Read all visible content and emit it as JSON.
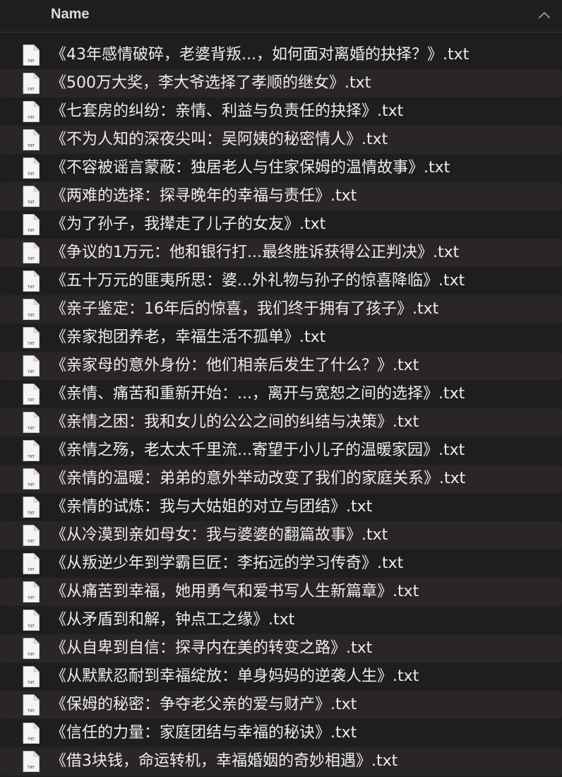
{
  "header": {
    "column_name": "Name",
    "sort_icon": "chevron-up-icon"
  },
  "file_icon": {
    "type": "txt-document-icon",
    "badge": "TXT"
  },
  "files": [
    "《43年感情破碎，老婆背叛...，如何面对离婚的抉择？》.txt",
    "《500万大奖，李大爷选择了孝顺的继女》.txt",
    "《七套房的纠纷：亲情、利益与负责任的抉择》.txt",
    "《不为人知的深夜尖叫：吴阿姨的秘密情人》.txt",
    "《不容被谣言蒙蔽：独居老人与住家保姆的温情故事》.txt",
    "《两难的选择：探寻晚年的幸福与责任》.txt",
    "《为了孙子，我撵走了儿子的女友》.txt",
    "《争议的1万元：他和银行打...最终胜诉获得公正判决》.txt",
    "《五十万元的匪夷所思：婆...外礼物与孙子的惊喜降临》.txt",
    "《亲子鉴定：16年后的惊喜，我们终于拥有了孩子》.txt",
    "《亲家抱团养老，幸福生活不孤单》.txt",
    "《亲家母的意外身份：他们相亲后发生了什么？》.txt",
    "《亲情、痛苦和重新开始：...，离开与宽恕之间的选择》.txt",
    "《亲情之困：我和女儿的公公之间的纠结与决策》.txt",
    "《亲情之殇，老太太千里流...寄望于小儿子的温暖家园》.txt",
    "《亲情的温暖：弟弟的意外举动改变了我们的家庭关系》.txt",
    "《亲情的试炼：我与大姑姐的对立与团结》.txt",
    "《从冷漠到亲如母女：我与婆婆的翻篇故事》.txt",
    "《从叛逆少年到学霸巨匠：李拓远的学习传奇》.txt",
    "《从痛苦到幸福，她用勇气和爱书写人生新篇章》.txt",
    "《从矛盾到和解，钟点工之缘》.txt",
    "《从自卑到自信：探寻内在美的转变之路》.txt",
    "《从默默忍耐到幸福绽放：单身妈妈的逆袭人生》.txt",
    "《保姆的秘密：争夺老父亲的爱与财产》.txt",
    "《信任的力量：家庭团结与幸福的秘诀》.txt",
    "《借3块钱，命运转机，幸福婚姻的奇妙相遇》.txt"
  ],
  "colors": {
    "background": "#1e1e1e",
    "alt_row": "#2a2625",
    "text": "#ececec",
    "header_text": "#d9d9d9"
  }
}
